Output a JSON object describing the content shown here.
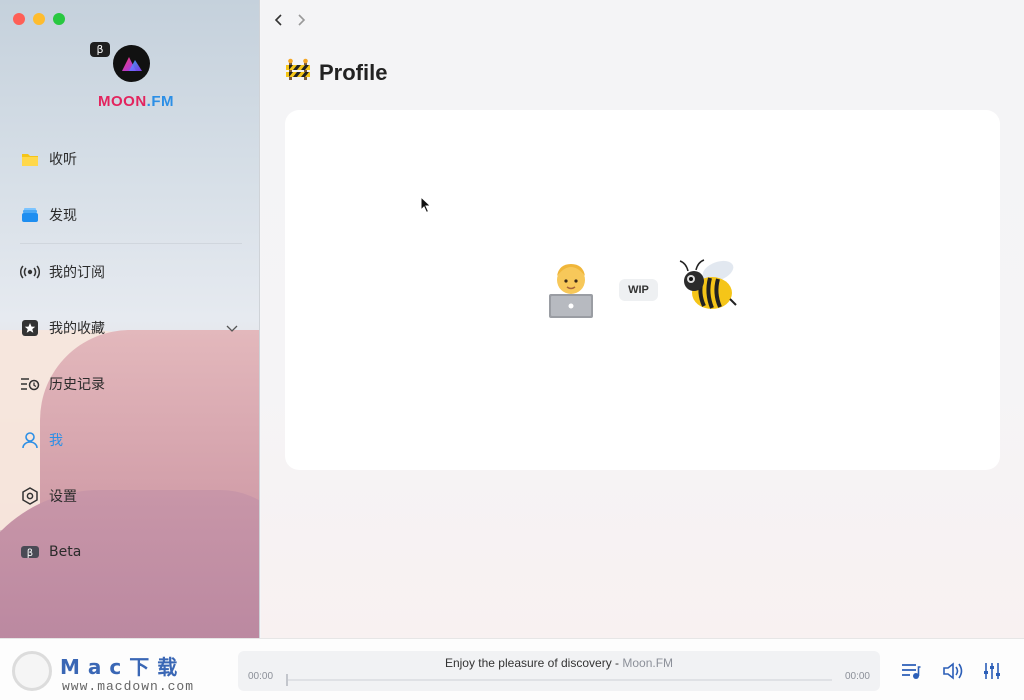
{
  "app": {
    "name_part1": "MOON",
    "name_part2": ".FM",
    "beta_symbol": "β"
  },
  "sidebar": {
    "items": [
      {
        "label": "收听",
        "icon": "folder-yellow-icon"
      },
      {
        "label": "发现",
        "icon": "layers-blue-icon"
      },
      {
        "label": "我的订阅",
        "icon": "broadcast-icon"
      },
      {
        "label": "我的收藏",
        "icon": "star-box-icon"
      },
      {
        "label": "历史记录",
        "icon": "history-list-icon"
      },
      {
        "label": "我",
        "icon": "user-icon",
        "active": true
      },
      {
        "label": "设置",
        "icon": "hexagon-settings-icon"
      },
      {
        "label": "Beta",
        "icon": "beta-badge-icon"
      }
    ]
  },
  "main": {
    "title": "Profile",
    "title_emoji": "construction-barrier-icon",
    "wip_label": "WIP"
  },
  "player": {
    "tagline": "Enjoy the pleasure of discovery - ",
    "brand": "Moon.FM",
    "time_elapsed": "00:00",
    "time_total": "00:00"
  },
  "watermark": {
    "text": "Mac下载",
    "url": "www.macdown.com"
  },
  "colors": {
    "accent": "#2c8fe6",
    "brand_red": "#e3245e"
  }
}
